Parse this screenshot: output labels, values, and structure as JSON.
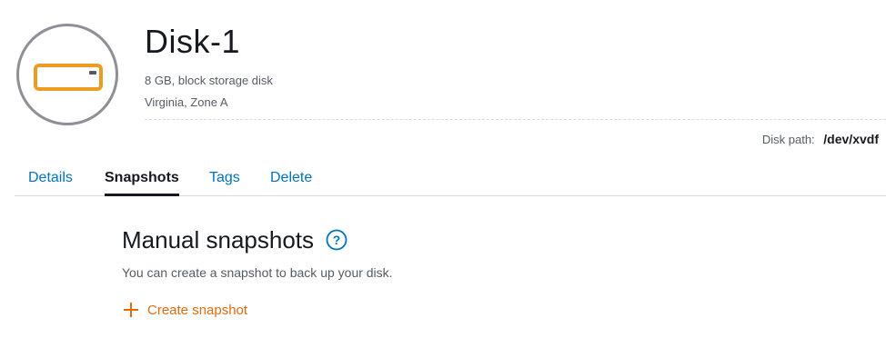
{
  "disk": {
    "name": "Disk-1",
    "description": "8 GB, block storage disk",
    "location": "Virginia, Zone A",
    "path_label": "Disk path:",
    "path_value": "/dev/xvdf",
    "icon": "block-storage-disk-icon"
  },
  "tabs": [
    {
      "label": "Details",
      "active": false
    },
    {
      "label": "Snapshots",
      "active": true
    },
    {
      "label": "Tags",
      "active": false
    },
    {
      "label": "Delete",
      "active": false
    }
  ],
  "snapshots": {
    "title": "Manual snapshots",
    "help_icon": "question-circle-icon",
    "description": "You can create a snapshot to back up your disk.",
    "create_label": "Create snapshot",
    "create_icon": "plus-icon"
  },
  "colors": {
    "accent_orange": "#dd6b10",
    "link_blue": "#0073bb",
    "text_dark": "#16191f",
    "text_muted": "#545b64",
    "avatar_ring": "#8d9096",
    "disk_orange": "#ec9c21"
  }
}
